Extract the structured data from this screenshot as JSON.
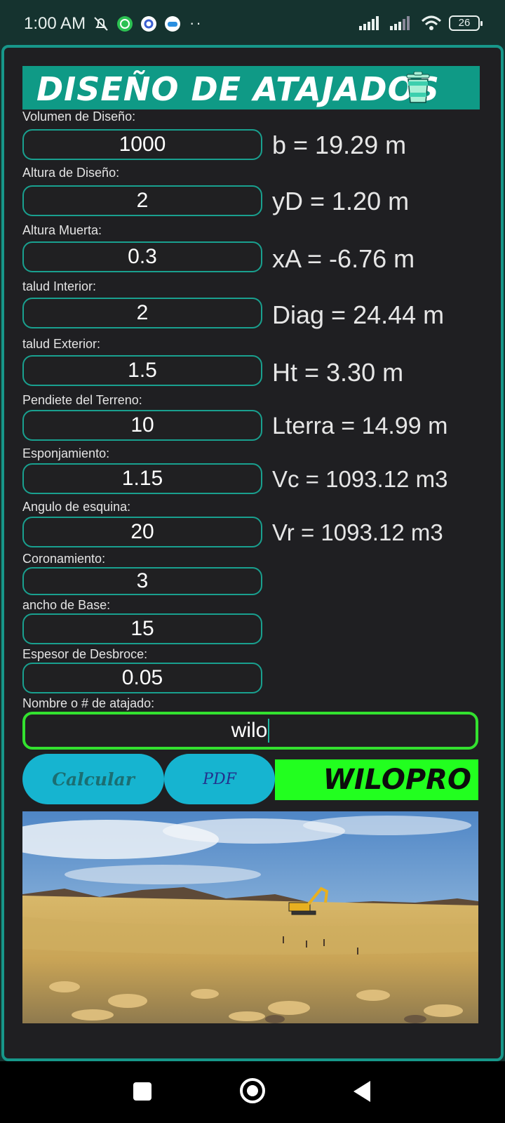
{
  "status_bar": {
    "time": "1:00 AM",
    "more": "··",
    "battery": "26",
    "icons": [
      "mute-icon",
      "whatsapp-icon",
      "settings-app-icon",
      "game-app-icon",
      "signal-icon",
      "signal-icon",
      "wifi-icon",
      "battery-icon"
    ]
  },
  "header": {
    "title": "DISEÑO DE ATAJADOS",
    "icon": "trash-icon",
    "bg_color": "#0f9a86"
  },
  "fields": [
    {
      "label": "Volumen de Diseño:",
      "value": "1000"
    },
    {
      "label": "Altura de Diseño:",
      "value": "2"
    },
    {
      "label": "Altura Muerta:",
      "value": "0.3"
    },
    {
      "label": "talud Interior:",
      "value": "2"
    },
    {
      "label": "talud Exterior:",
      "value": "1.5"
    },
    {
      "label": "Pendiete del Terreno:",
      "value": "10"
    },
    {
      "label": "Esponjamiento:",
      "value": "1.15"
    },
    {
      "label": "Angulo de esquina:",
      "value": "20"
    },
    {
      "label": "Coronamiento:",
      "value": "3"
    },
    {
      "label": "ancho de Base:",
      "value": "15"
    },
    {
      "label": "Espesor de Desbroce:",
      "value": "0.05"
    }
  ],
  "results": [
    "b = 19.29 m",
    "yD = 1.20 m",
    "xA = -6.76 m",
    "Diag = 24.44 m",
    "Ht = 3.30 m",
    "Lterra = 14.99 m",
    "Vc = 1093.12 m3",
    "Vr = 1093.12 m3"
  ],
  "name_field": {
    "label": "Nombre o # de atajado:",
    "value": "wilo"
  },
  "buttons": {
    "calculate": "Calcular",
    "pdf": "PDF",
    "brand": "WILOPRO"
  },
  "colors": {
    "accent": "#17978a",
    "button": "#16b4d0",
    "brand_green": "#22ff1f",
    "name_border": "#33e12f"
  }
}
